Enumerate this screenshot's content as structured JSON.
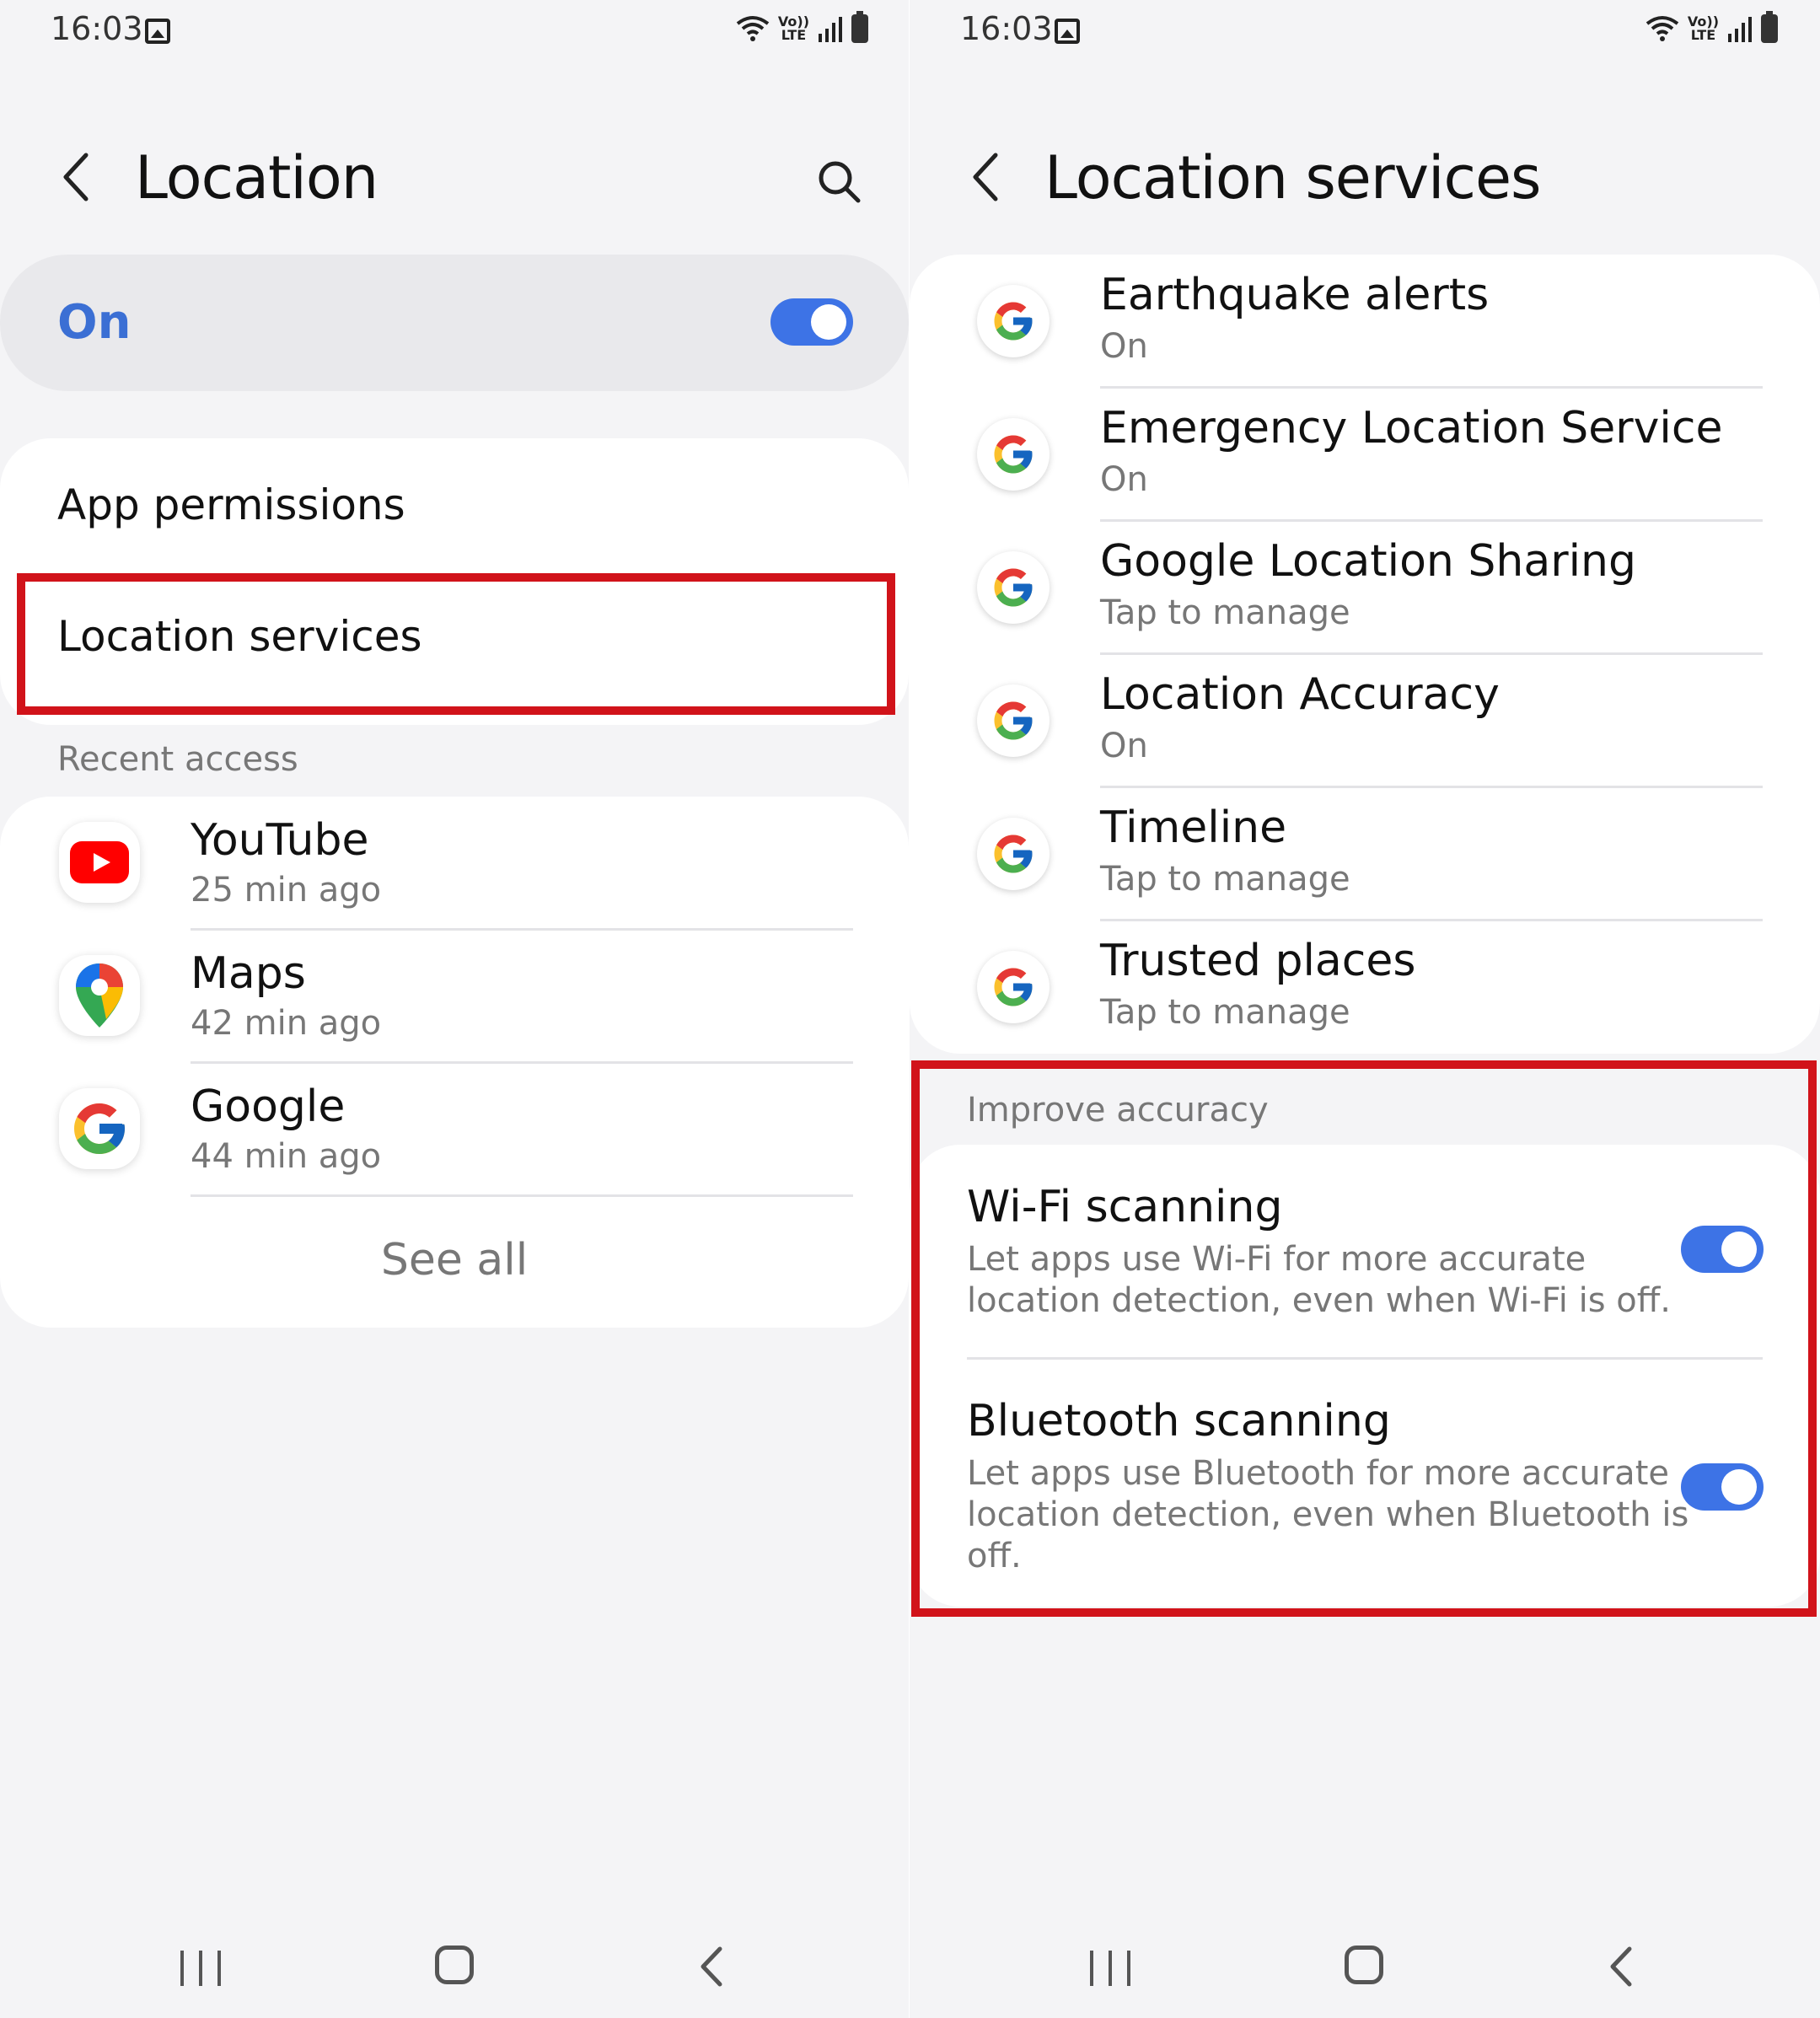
{
  "status": {
    "time": "16:03",
    "volte_top": "Vo))",
    "volte_bottom": "LTE"
  },
  "left": {
    "title": "Location",
    "master": {
      "label": "On",
      "toggle_on": true
    },
    "menu": [
      {
        "label": "App permissions"
      },
      {
        "label": "Location services"
      }
    ],
    "recent_access_label": "Recent access",
    "recent": [
      {
        "name": "YouTube",
        "time": "25 min ago",
        "icon": "youtube-icon"
      },
      {
        "name": "Maps",
        "time": "42 min ago",
        "icon": "maps-icon"
      },
      {
        "name": "Google",
        "time": "44 min ago",
        "icon": "google-icon"
      }
    ],
    "see_all": "See all"
  },
  "right": {
    "title": "Location services",
    "services": [
      {
        "title": "Earthquake alerts",
        "sub": "On"
      },
      {
        "title": "Emergency Location Service",
        "sub": "On"
      },
      {
        "title": "Google Location Sharing",
        "sub": "Tap to manage"
      },
      {
        "title": "Location Accuracy",
        "sub": "On"
      },
      {
        "title": "Timeline",
        "sub": "Tap to manage"
      },
      {
        "title": "Trusted places",
        "sub": "Tap to manage"
      }
    ],
    "improve_label": "Improve accuracy",
    "wifi": {
      "title": "Wi-Fi scanning",
      "desc_1": "Let apps use Wi-Fi for more accurate",
      "desc_2": "location detection, even when Wi-Fi is off.",
      "toggle_on": true
    },
    "bluetooth": {
      "title": "Bluetooth scanning",
      "desc_1": "Let apps use Bluetooth for more accurate",
      "desc_2": "location detection, even when Bluetooth is",
      "desc_3": "off.",
      "toggle_on": true
    }
  },
  "colors": {
    "accent": "#3d73e6",
    "highlight": "#d1131a",
    "on_label": "#3b6fd4"
  }
}
